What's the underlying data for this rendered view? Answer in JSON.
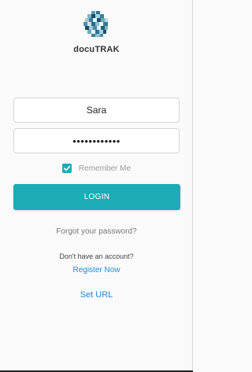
{
  "app": {
    "name": "docuTRAK",
    "logo_icon": "docutrak-mosaic-logo-icon"
  },
  "form": {
    "username_value": "Sara",
    "password_value": "••••••••••••",
    "remember_label": "Remember Me",
    "remember_checked": true,
    "login_label": "LOGIN"
  },
  "links": {
    "forgot_password": "Forgot your password?",
    "no_account": "Don't have an account?",
    "register": "Register Now",
    "set_url": "Set URL"
  },
  "colors": {
    "accent": "#1bacb6",
    "link": "#1e8bd8",
    "background": "#fafafa"
  }
}
